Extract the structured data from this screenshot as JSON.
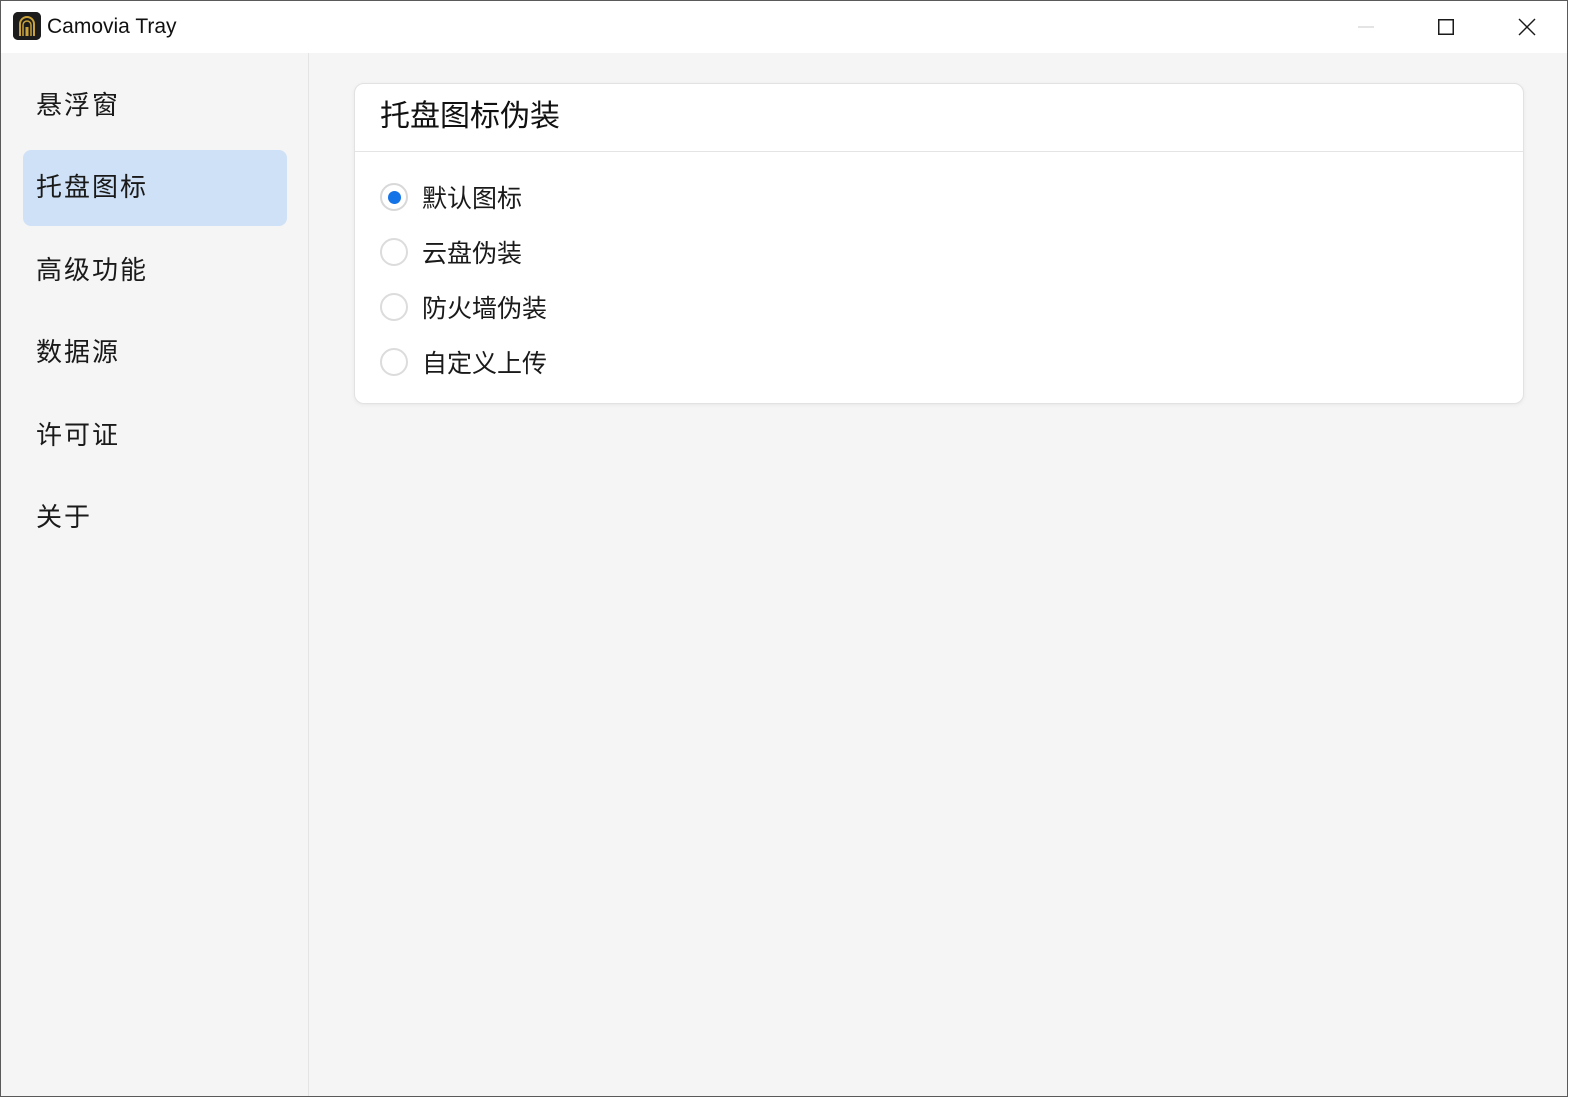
{
  "window": {
    "title": "Camovia Tray",
    "controls": {
      "minimize_icon": "minimize-icon",
      "maximize_icon": "maximize-icon",
      "close_icon": "close-icon"
    }
  },
  "sidebar": {
    "items": [
      {
        "label": "悬浮窗",
        "active": false
      },
      {
        "label": "托盘图标",
        "active": true
      },
      {
        "label": "高级功能",
        "active": false
      },
      {
        "label": "数据源",
        "active": false
      },
      {
        "label": "许可证",
        "active": false
      },
      {
        "label": "关于",
        "active": false
      }
    ]
  },
  "main": {
    "card": {
      "title": "托盘图标伪装",
      "options": [
        {
          "label": "默认图标",
          "checked": true
        },
        {
          "label": "云盘伪装",
          "checked": false
        },
        {
          "label": "防火墙伪装",
          "checked": false
        },
        {
          "label": "自定义上传",
          "checked": false
        }
      ]
    }
  },
  "colors": {
    "accent": "#1473e6",
    "active_nav_bg": "#cfe1f7",
    "background": "#f5f5f5"
  }
}
